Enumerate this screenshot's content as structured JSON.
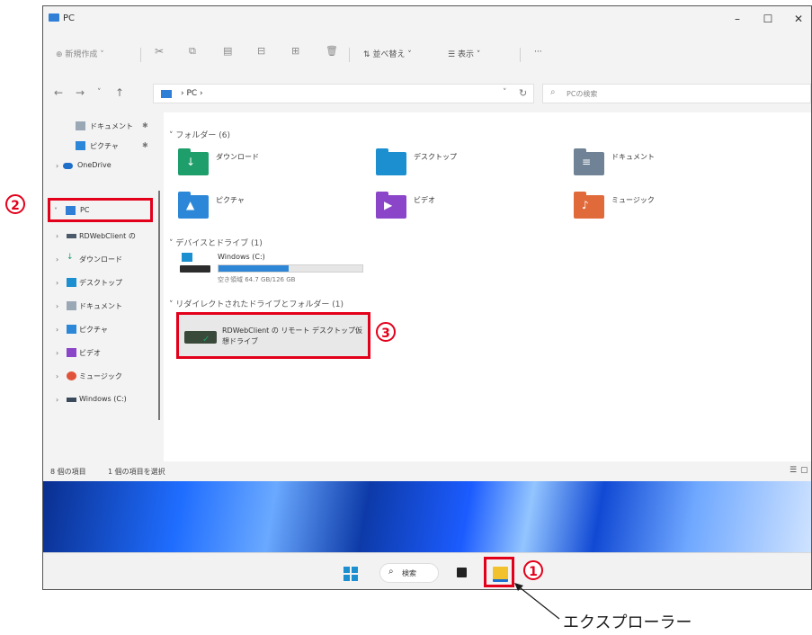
{
  "window": {
    "title": "PC",
    "controls": {
      "minimize": "–",
      "maximize": "☐",
      "close": "✕"
    }
  },
  "toolbar": {
    "new_label": "新規作成",
    "sort_label": "並べ替え",
    "view_label": "表示",
    "more_label": "···"
  },
  "address": {
    "path": "PC",
    "search_placeholder": "PCの検索"
  },
  "sidebar": {
    "items": [
      {
        "label": "ドキュメント",
        "icon": "document-icon",
        "pinned": true
      },
      {
        "label": "ピクチャ",
        "icon": "pictures-icon",
        "pinned": true
      },
      {
        "label": "OneDrive",
        "icon": "cloud-icon",
        "pinned": false
      },
      {
        "label": "PC",
        "icon": "computer-icon",
        "pinned": false,
        "selected": true
      },
      {
        "label": "RDWebClient の",
        "icon": "network-drive-icon",
        "pinned": false
      },
      {
        "label": "ダウンロード",
        "icon": "download-icon",
        "pinned": false
      },
      {
        "label": "デスクトップ",
        "icon": "desktop-icon",
        "pinned": false
      },
      {
        "label": "ドキュメント",
        "icon": "document-icon",
        "pinned": false
      },
      {
        "label": "ピクチャ",
        "icon": "pictures-icon",
        "pinned": false
      },
      {
        "label": "ビデオ",
        "icon": "video-icon",
        "pinned": false
      },
      {
        "label": "ミュージック",
        "icon": "music-icon",
        "pinned": false
      },
      {
        "label": "Windows (C:)",
        "icon": "drive-icon",
        "pinned": false
      }
    ]
  },
  "content": {
    "folders_header": "フォルダー (6)",
    "folders": [
      {
        "label": "ダウンロード",
        "icon": "download-folder-icon",
        "color": "#1e9e6a",
        "glyph": "↓"
      },
      {
        "label": "デスクトップ",
        "icon": "desktop-folder-icon",
        "color": "#1b8fd0",
        "glyph": ""
      },
      {
        "label": "ドキュメント",
        "icon": "documents-folder-icon",
        "color": "#6f8296",
        "glyph": "≡"
      },
      {
        "label": "ピクチャ",
        "icon": "pictures-folder-icon",
        "color": "#2d87d8",
        "glyph": "▲"
      },
      {
        "label": "ビデオ",
        "icon": "videos-folder-icon",
        "color": "#8b45c8",
        "glyph": "▶"
      },
      {
        "label": "ミュージック",
        "icon": "music-folder-icon",
        "color": "#e06a3a",
        "glyph": "♪"
      }
    ],
    "devices_header": "デバイスとドライブ (1)",
    "drive": {
      "label": "Windows (C:)",
      "free_text": "空き領域 64.7 GB/126 GB",
      "used_fraction": 0.49
    },
    "redirected_header": "リダイレクトされたドライブとフォルダー (1)",
    "redirected": {
      "label_line1": "RDWebClient の リモート デスクトップ仮",
      "label_line2": "想ドライブ"
    }
  },
  "status": {
    "count": "8 個の項目",
    "selected": "1 個の項目を選択"
  },
  "taskbar": {
    "search_label": "検索"
  },
  "annotations": {
    "num1": "1",
    "num2": "2",
    "num3": "3",
    "callout": "エクスプローラー",
    "color": "#e3001b"
  }
}
